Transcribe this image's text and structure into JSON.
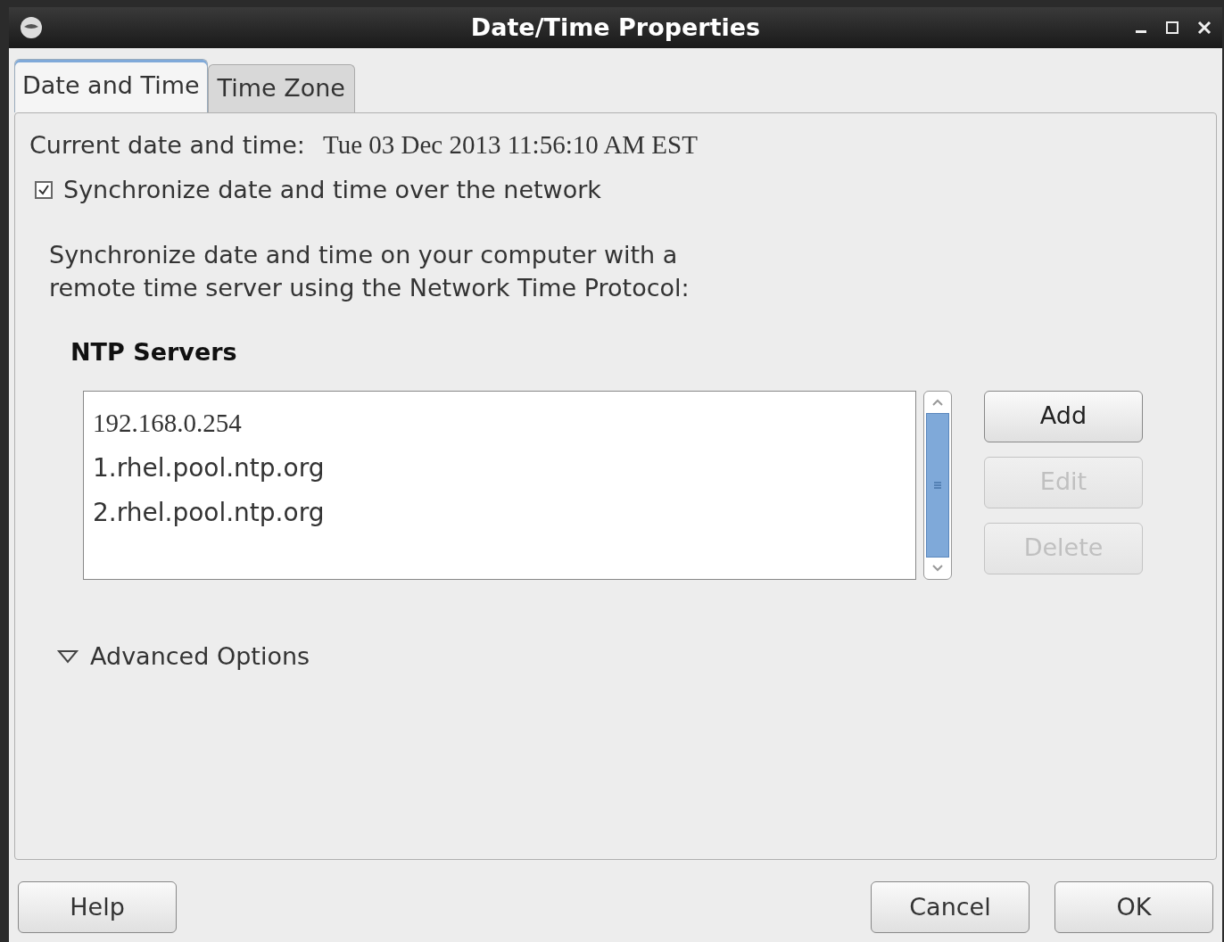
{
  "window": {
    "title": "Date/Time Properties"
  },
  "tabs": [
    {
      "label": "Date and Time",
      "selected": true
    },
    {
      "label": "Time Zone",
      "selected": false
    }
  ],
  "current": {
    "label": "Current date and time:",
    "value": "Tue 03 Dec 2013 11:56:10 AM EST"
  },
  "sync": {
    "label": "Synchronize date and time over the network",
    "checked": true
  },
  "description": "Synchronize date and time on your computer with a remote time server using the Network Time Protocol:",
  "ntp": {
    "heading": "NTP Servers",
    "servers": [
      "192.168.0.254",
      "1.rhel.pool.ntp.org",
      "2.rhel.pool.ntp.org"
    ],
    "buttons": [
      {
        "label": "Add",
        "disabled": false
      },
      {
        "label": "Edit",
        "disabled": true
      },
      {
        "label": "Delete",
        "disabled": true
      }
    ]
  },
  "advanced": {
    "label": "Advanced Options",
    "expanded": false
  },
  "footer": {
    "left": [
      {
        "label": "Help"
      }
    ],
    "right": [
      {
        "label": "Cancel"
      },
      {
        "label": "OK"
      }
    ]
  }
}
